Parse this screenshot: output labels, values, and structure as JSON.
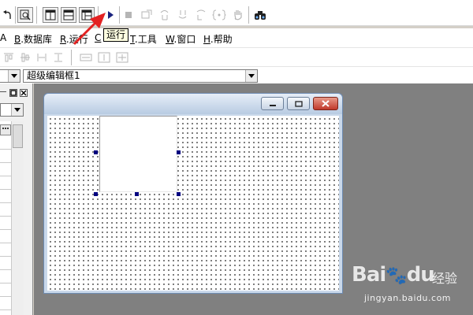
{
  "toolbar": {
    "tooltip": "运行",
    "buttons": [
      {
        "name": "undo",
        "icon": "undo-icon"
      },
      {
        "name": "find",
        "icon": "find-window-icon"
      },
      {
        "name": "layout-1",
        "icon": "window-layout-icon"
      },
      {
        "name": "layout-2",
        "icon": "window-layout-icon"
      },
      {
        "name": "layout-3",
        "icon": "window-layout-icon"
      },
      {
        "name": "run",
        "icon": "play-icon"
      },
      {
        "name": "stop",
        "icon": "stop-icon"
      },
      {
        "name": "step-into",
        "icon": "step-icon"
      },
      {
        "name": "step-over",
        "icon": "step-icon"
      },
      {
        "name": "step-out",
        "icon": "step-icon"
      },
      {
        "name": "run-to-cursor",
        "icon": "step-icon"
      },
      {
        "name": "set-breakpoint",
        "icon": "braces-icon"
      },
      {
        "name": "hand",
        "icon": "hand-icon"
      },
      {
        "name": "watch",
        "icon": "binoculars-icon"
      }
    ]
  },
  "menubar": {
    "items": [
      {
        "key": "",
        "text": "A"
      },
      {
        "key": "B",
        "text": ".数据库"
      },
      {
        "key": "R",
        "text": ".运行"
      },
      {
        "key": "C",
        "text": ""
      },
      {
        "key": "T",
        "text": ".工具"
      },
      {
        "key": "W",
        "text": ".窗口"
      },
      {
        "key": "H",
        "text": ".帮助"
      }
    ]
  },
  "object_selector": {
    "value": "超级编辑框1"
  },
  "colors": {
    "accent_arrow": "#e32222",
    "handle": "#000080",
    "workspace": "#808080",
    "run_icon": "#1a237e"
  }
}
